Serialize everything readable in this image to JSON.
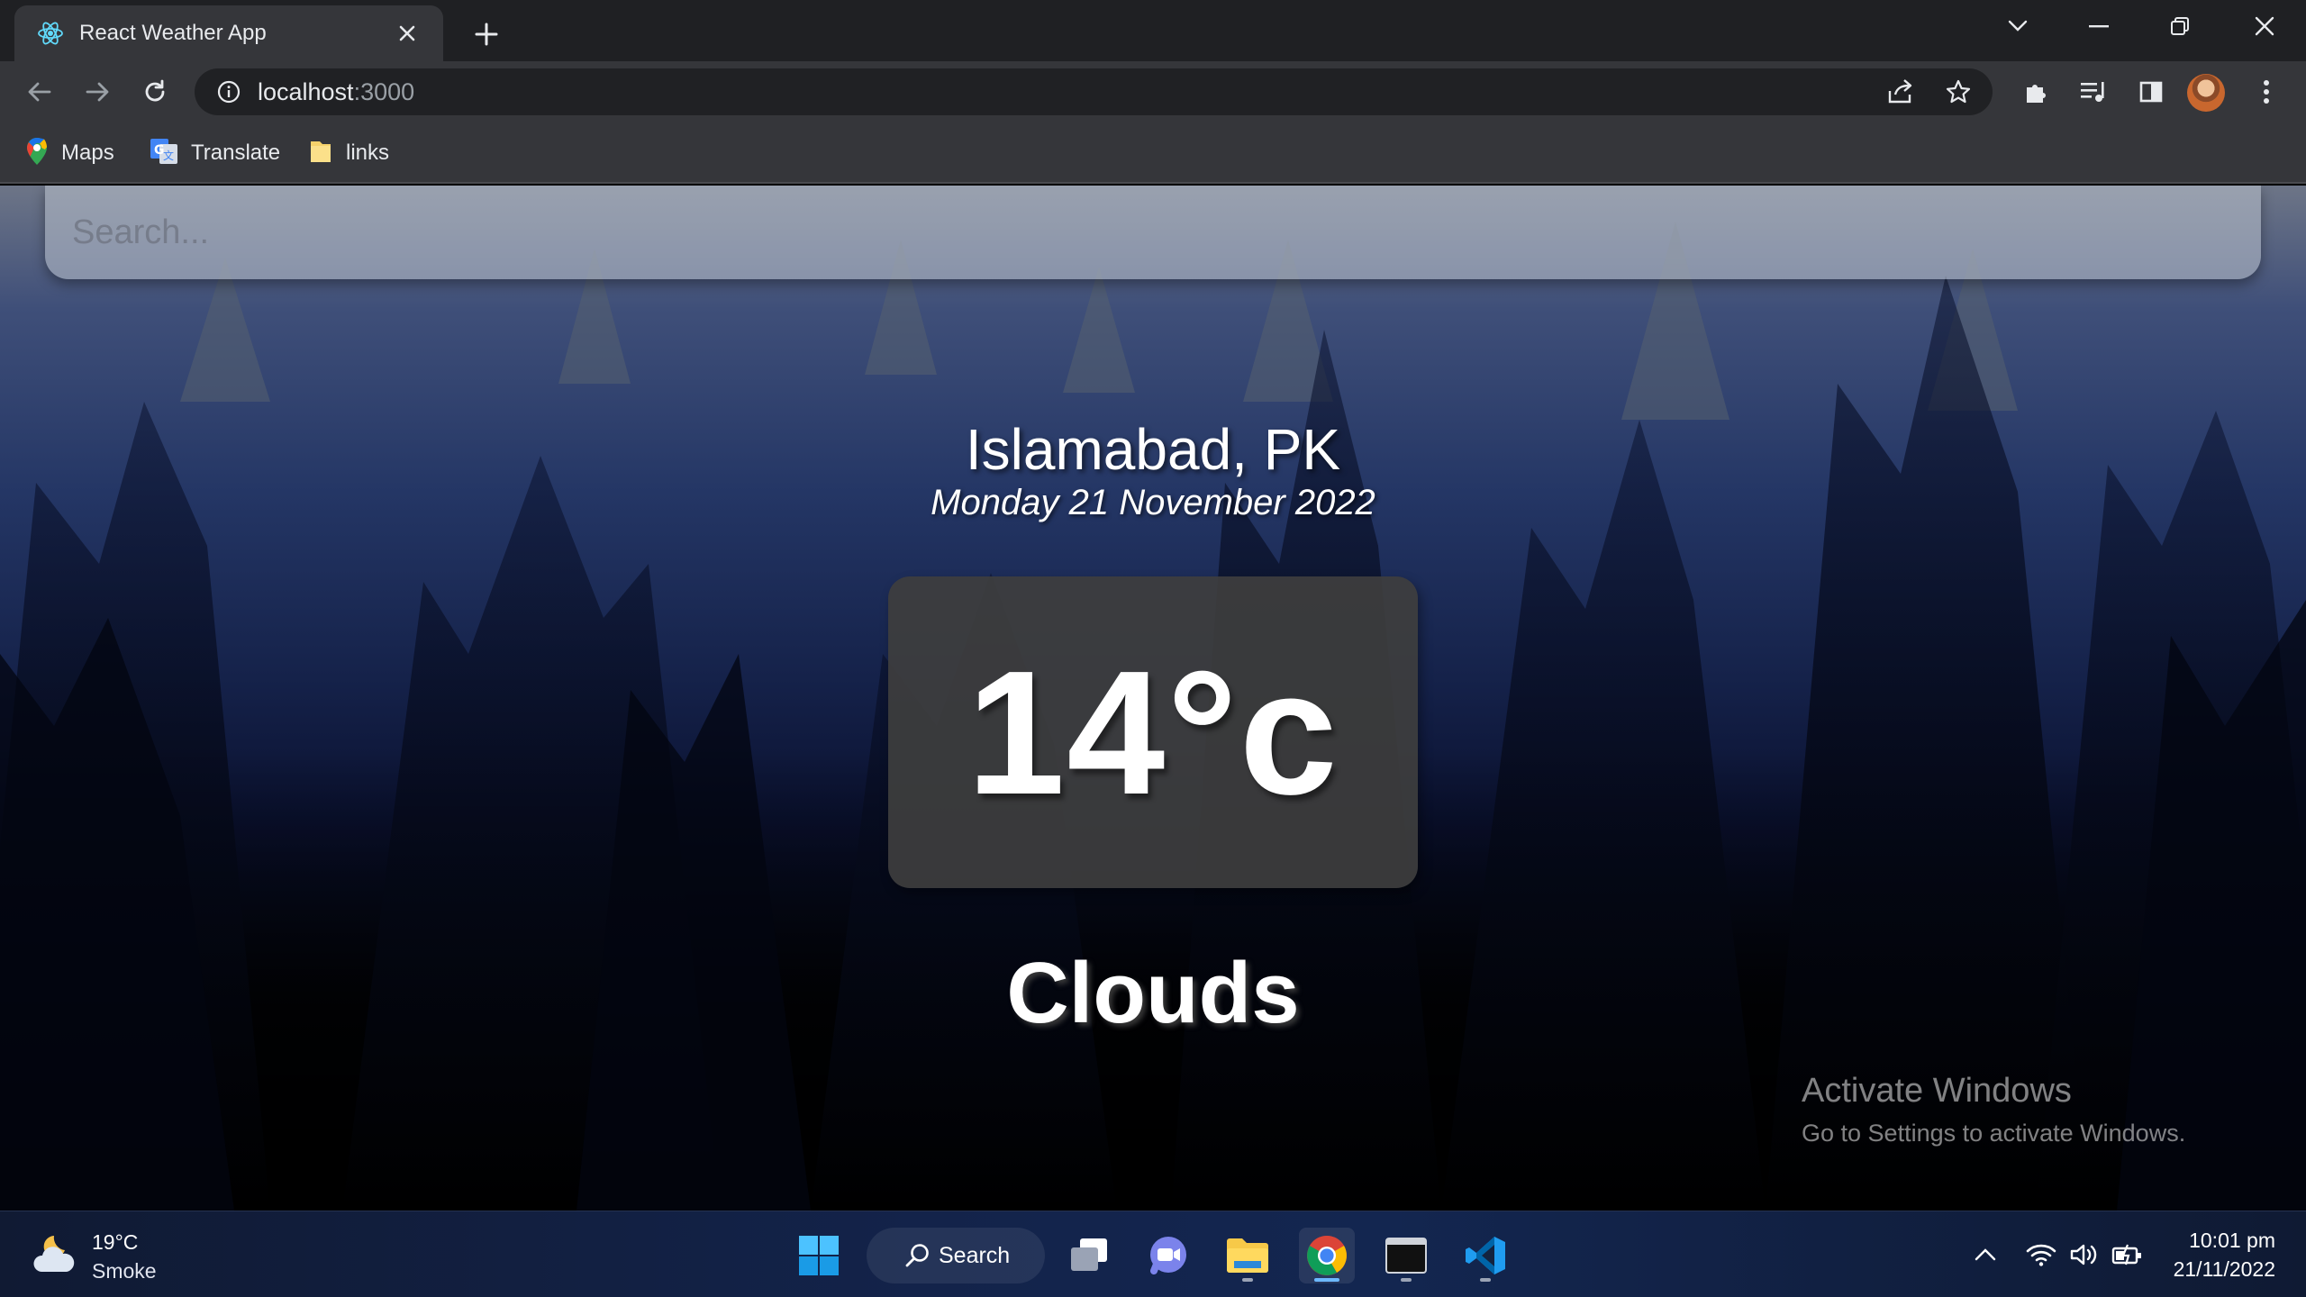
{
  "browser": {
    "tab_title": "React Weather App",
    "url_host": "localhost",
    "url_port": ":3000",
    "bookmarks": [
      {
        "label": "Maps",
        "icon": "google-maps-icon"
      },
      {
        "label": "Translate",
        "icon": "google-translate-icon"
      },
      {
        "label": "links",
        "icon": "folder-icon"
      }
    ]
  },
  "app": {
    "search_placeholder": "Search...",
    "location": "Islamabad, PK",
    "date": "Monday 21 November 2022",
    "temperature": "14°c",
    "weather": "Clouds"
  },
  "watermark": {
    "title": "Activate Windows",
    "subtitle": "Go to Settings to activate Windows."
  },
  "taskbar": {
    "weather_temp": "19°C",
    "weather_desc": "Smoke",
    "search_label": "Search",
    "clock_time": "10:01 pm",
    "clock_date": "21/11/2022",
    "apps": [
      "start",
      "task-view",
      "teams-chat",
      "file-explorer",
      "chrome",
      "terminal",
      "vs-code"
    ]
  },
  "colors": {
    "accent": "#6cb8ff",
    "tab_bg": "#35363a",
    "temp_box": "#3e3e3e"
  }
}
